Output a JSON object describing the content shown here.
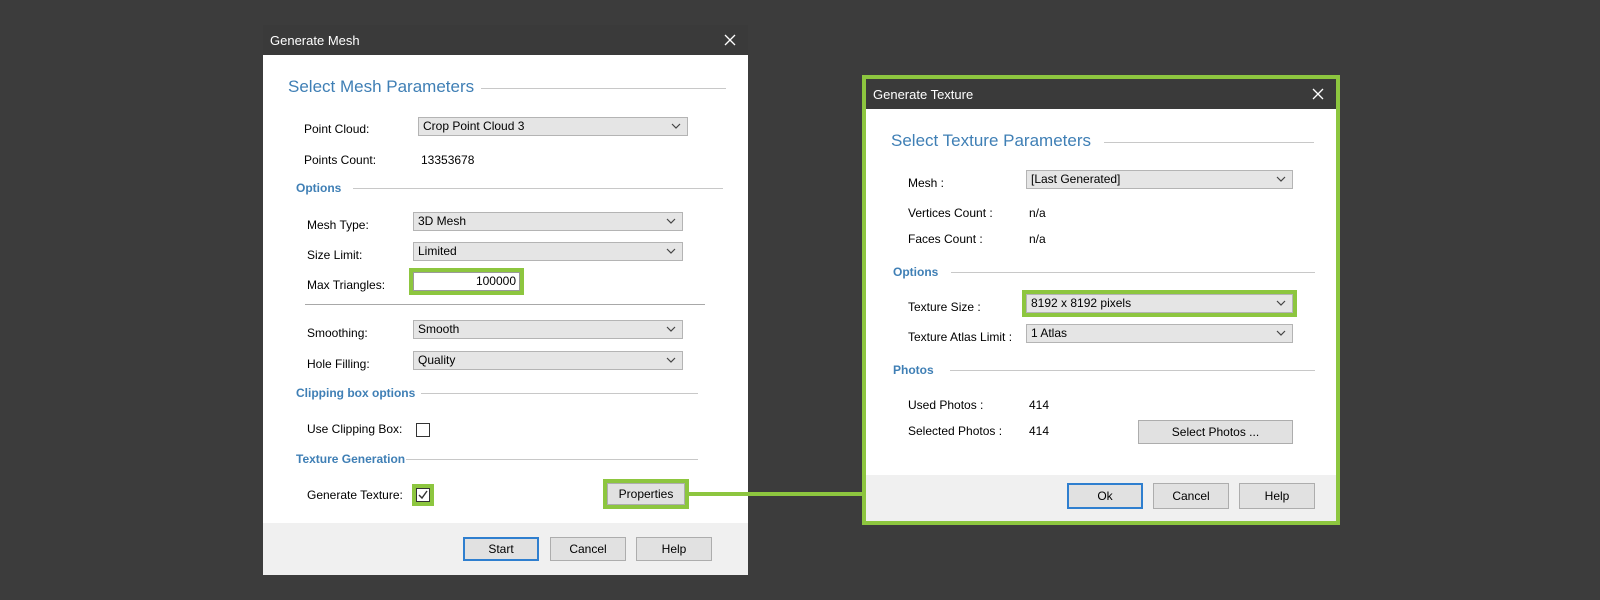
{
  "mesh_dialog": {
    "title": "Generate Mesh",
    "section_title": "Select Mesh Parameters",
    "point_cloud_label": "Point Cloud:",
    "point_cloud_value": "Crop Point Cloud 3",
    "points_count_label": "Points Count:",
    "points_count_value": "13353678",
    "options_title": "Options",
    "mesh_type_label": "Mesh Type:",
    "mesh_type_value": "3D Mesh",
    "size_limit_label": "Size Limit:",
    "size_limit_value": "Limited",
    "max_triangles_label": "Max Triangles:",
    "max_triangles_value": "100000",
    "smoothing_label": "Smoothing:",
    "smoothing_value": "Smooth",
    "hole_filling_label": "Hole Filling:",
    "hole_filling_value": "Quality",
    "clipping_title": "Clipping box options",
    "use_clipping_label": "Use Clipping Box:",
    "use_clipping_checked": false,
    "texture_gen_title": "Texture Generation",
    "generate_texture_label": "Generate Texture:",
    "generate_texture_checked": true,
    "properties_button": "Properties",
    "start_button": "Start",
    "cancel_button": "Cancel",
    "help_button": "Help"
  },
  "texture_dialog": {
    "title": "Generate Texture",
    "section_title": "Select Texture Parameters",
    "mesh_label": "Mesh :",
    "mesh_value": "[Last Generated]",
    "vertices_label": "Vertices Count :",
    "vertices_value": "n/a",
    "faces_label": "Faces Count :",
    "faces_value": "n/a",
    "options_title": "Options",
    "texture_size_label": "Texture Size :",
    "texture_size_value": "8192 x 8192 pixels",
    "atlas_label": "Texture Atlas Limit :",
    "atlas_value": "1 Atlas",
    "photos_title": "Photos",
    "used_photos_label": "Used Photos :",
    "used_photos_value": "414",
    "selected_photos_label": "Selected Photos :",
    "selected_photos_value": "414",
    "select_photos_button": "Select Photos ...",
    "ok_button": "Ok",
    "cancel_button": "Cancel",
    "help_button": "Help"
  },
  "icons": {
    "close": "close-icon",
    "dropdown": "chevron-down-icon",
    "checkmark": "check-icon"
  },
  "colors": {
    "background": "#3c3c3c",
    "titlebar": "#3a3a3a",
    "accent_blue": "#3f7fb5",
    "highlight_green": "#8dc63f"
  }
}
